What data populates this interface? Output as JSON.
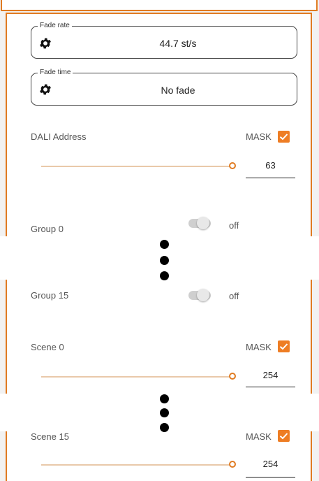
{
  "fade_rate": {
    "legend": "Fade rate",
    "value": "44.7 st/s",
    "icon": "gear-icon"
  },
  "fade_time": {
    "legend": "Fade time",
    "value": "No fade",
    "icon": "gear-icon"
  },
  "dali_address": {
    "label": "DALI Address",
    "mask_label": "MASK",
    "mask_checked": true,
    "value": "63",
    "slider_level": 1.0
  },
  "group_first": {
    "label": "Group 0",
    "state": "off"
  },
  "group_last": {
    "label": "Group 15",
    "state": "off"
  },
  "scene_first": {
    "label": "Scene 0",
    "mask_label": "MASK",
    "mask_checked": true,
    "value": "254",
    "slider_level": 1.0
  },
  "scene_last": {
    "label": "Scene 15",
    "mask_label": "MASK",
    "mask_checked": true,
    "value": "254",
    "slider_level": 1.0
  },
  "colors": {
    "accent": "#ee7d24",
    "border": "#e07b22"
  }
}
